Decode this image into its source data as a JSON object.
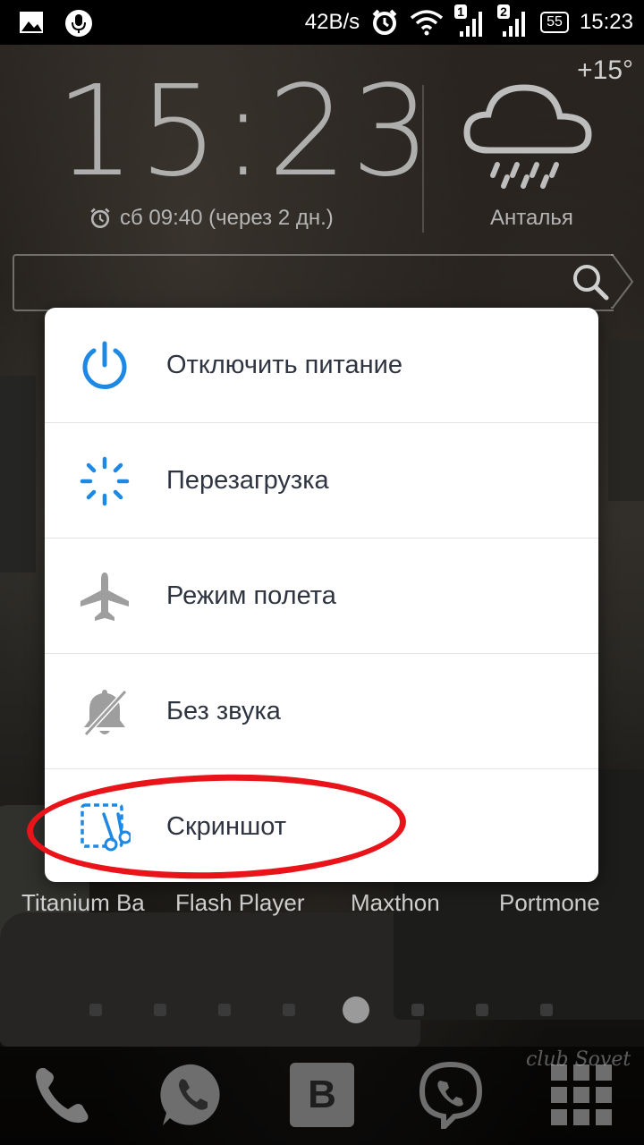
{
  "status_bar": {
    "net_speed": "42B/s",
    "sim1": "1",
    "sim2": "2",
    "battery": "55",
    "time": "15:23",
    "icons": [
      "gallery-icon",
      "microphone-icon",
      "alarm-icon",
      "wifi-icon",
      "signal-icon",
      "signal-icon",
      "battery-icon"
    ]
  },
  "widget": {
    "clock": "15:23",
    "alarm": "сб 09:40 (через 2 дн.)",
    "temperature": "+15°",
    "city": "Анталья",
    "weather_icon": "rain-cloud-icon"
  },
  "power_menu": {
    "items": [
      {
        "label": "Отключить питание",
        "icon": "power-icon"
      },
      {
        "label": "Перезагрузка",
        "icon": "reboot-icon"
      },
      {
        "label": "Режим полета",
        "icon": "airplane-icon"
      },
      {
        "label": "Без звука",
        "icon": "silent-icon"
      },
      {
        "label": "Скриншот",
        "icon": "screenshot-icon"
      }
    ],
    "accent": "#1e88e5"
  },
  "apps": [
    "Titanium Ba",
    "Flash Player",
    "Maxthon",
    "Portmone"
  ],
  "dock": [
    "phone-icon",
    "whatsapp-icon",
    "vk-icon",
    "viber-icon",
    "apps-grid-icon"
  ],
  "watermark": "club Sovet",
  "annotation_color": "#e8141a"
}
